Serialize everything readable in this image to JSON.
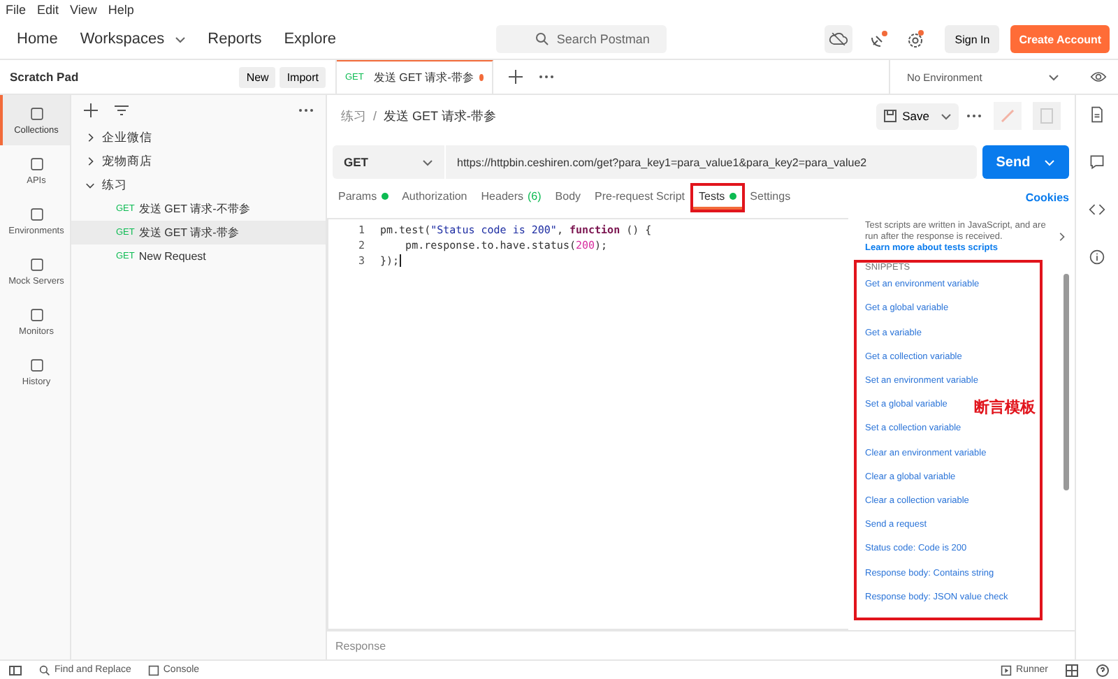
{
  "menu": [
    "File",
    "Edit",
    "View",
    "Help"
  ],
  "nav": [
    {
      "label": "Home",
      "kind": "link"
    },
    {
      "label": "Workspaces",
      "kind": "dropdown"
    },
    {
      "label": "Reports",
      "kind": "link"
    },
    {
      "label": "Explore",
      "kind": "link"
    }
  ],
  "search": {
    "placeholder": "Search Postman"
  },
  "account": {
    "sign_in": "Sign In",
    "create": "Create Account"
  },
  "sidebar": {
    "title": "Scratch Pad",
    "buttons": [
      "New",
      "Import"
    ],
    "rail": [
      {
        "label": "Collections",
        "selected": true
      },
      {
        "label": "APIs",
        "selected": false
      },
      {
        "label": "Environments",
        "selected": false
      },
      {
        "label": "Mock Servers",
        "selected": false
      },
      {
        "label": "Monitors",
        "selected": false
      },
      {
        "label": "History",
        "selected": false
      }
    ],
    "tree": [
      {
        "name": "企业微信",
        "expanded": false
      },
      {
        "name": "宠物商店",
        "expanded": false
      },
      {
        "name": "练习",
        "expanded": true,
        "children": [
          {
            "method": "GET",
            "name": "发送 GET 请求-不带参",
            "selected": false
          },
          {
            "method": "GET",
            "name": "发送 GET 请求-带参",
            "selected": true
          },
          {
            "method": "GET",
            "name": "New Request",
            "selected": false
          }
        ]
      }
    ]
  },
  "open_tab": {
    "method": "GET",
    "name": "发送 GET 请求-带参",
    "unsaved": true
  },
  "environment": "No Environment",
  "breadcrumb": {
    "parent": "练习",
    "separator": "/",
    "current": "发送 GET 请求-带参"
  },
  "save": "Save",
  "request": {
    "method": "GET",
    "url": "https://httpbin.ceshiren.com/get?para_key1=para_value1&para_key2=para_value2",
    "send": "Send"
  },
  "request_tabs": [
    {
      "label": "Params",
      "dot": true,
      "selected": false,
      "highlighted": false
    },
    {
      "label": "Authorization",
      "dot": false,
      "selected": false,
      "highlighted": false
    },
    {
      "label": "Headers",
      "count": "(6)",
      "dot": false,
      "selected": false,
      "highlighted": false
    },
    {
      "label": "Body",
      "dot": false,
      "selected": false,
      "highlighted": false
    },
    {
      "label": "Pre-request Script",
      "dot": false,
      "selected": false,
      "highlighted": false
    },
    {
      "label": "Tests",
      "dot": true,
      "selected": true,
      "highlighted": true
    },
    {
      "label": "Settings",
      "dot": false,
      "selected": false,
      "highlighted": false
    }
  ],
  "cookies": "Cookies",
  "editor": [
    {
      "number": "1",
      "tokens": [
        {
          "text": "pm.test(",
          "kind": "plain"
        },
        {
          "text": "\"Status code is 200\"",
          "kind": "string"
        },
        {
          "text": ", ",
          "kind": "plain"
        },
        {
          "text": "function",
          "kind": "keyword"
        },
        {
          "text": " () {",
          "kind": "plain"
        }
      ]
    },
    {
      "number": "2",
      "tokens": [
        {
          "text": "    pm.response.to.have.status(",
          "kind": "plain"
        },
        {
          "text": "200",
          "kind": "number"
        },
        {
          "text": ");",
          "kind": "plain"
        }
      ]
    },
    {
      "number": "3",
      "tokens": [
        {
          "text": "});",
          "kind": "plain"
        }
      ]
    }
  ],
  "snippets": {
    "help": "Test scripts are written in JavaScript, and are run after the response is received.",
    "learn_link": "Learn more about tests scripts",
    "heading": "SNIPPETS",
    "annotation": "断言模板",
    "items": [
      "Get an environment variable",
      "Get a global variable",
      "Get a variable",
      "Get a collection variable",
      "Set an environment variable",
      "Set a global variable",
      "Set a collection variable",
      "Clear an environment variable",
      "Clear a global variable",
      "Clear a collection variable",
      "Send a request",
      "Status code: Code is 200",
      "Response body: Contains string",
      "Response body: JSON value check"
    ]
  },
  "response_label": "Response",
  "status_bar": {
    "find": "Find and Replace",
    "console": "Console",
    "runner": "Runner"
  }
}
